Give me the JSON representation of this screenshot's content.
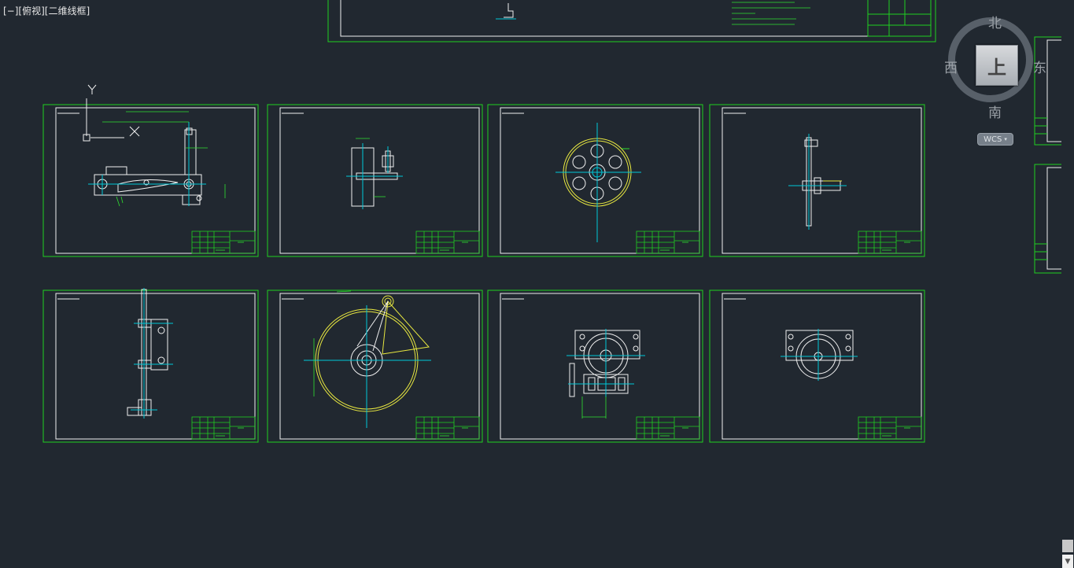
{
  "viewport": {
    "label": "[−][俯视][二维线框]"
  },
  "viewcube": {
    "north": "北",
    "south": "南",
    "west": "西",
    "east": "东",
    "face": "上",
    "wcs_label": "WCS",
    "wcs_caret": "▾"
  },
  "ucs": {
    "y_label": "Y"
  },
  "colors": {
    "background": "#212830",
    "frame": "#20d020",
    "geometry": "#f0f0f0",
    "centerline": "#00c8d8",
    "highlight": "#e8e840",
    "dimension": "#30e030"
  },
  "icons": [
    "ucs-icon",
    "viewcube-icon",
    "scroll-down-arrow-icon"
  ]
}
